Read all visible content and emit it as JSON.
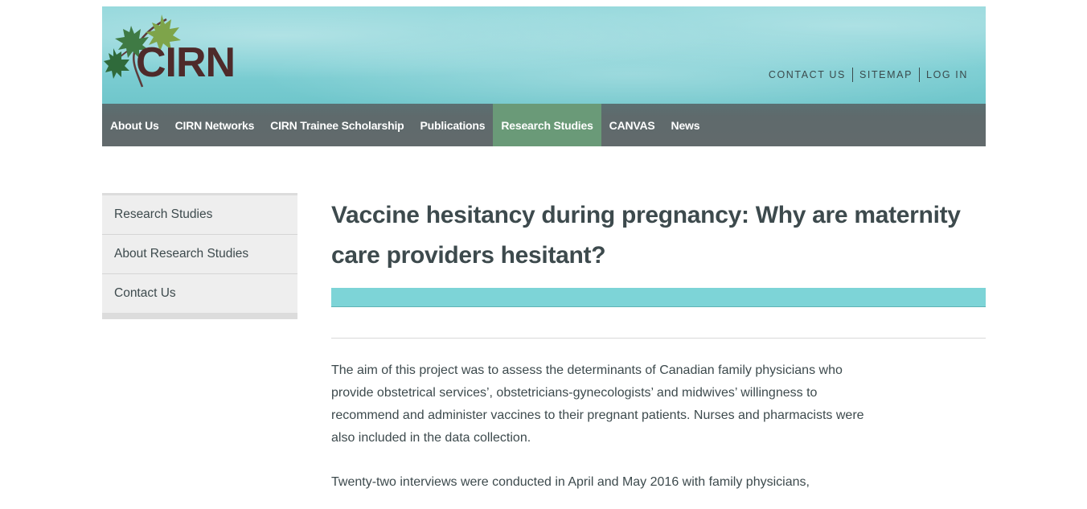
{
  "header": {
    "logo_text": "CIRN",
    "utility_links": [
      "CONTACT US",
      "SITEMAP",
      "LOG IN"
    ]
  },
  "nav": {
    "items": [
      "About Us",
      "CIRN Networks",
      "CIRN Trainee Scholarship",
      "Publications",
      "Research Studies",
      "CANVAS",
      "News"
    ],
    "active": "Research Studies"
  },
  "sidebar": {
    "items": [
      "Research Studies",
      "About Research Studies",
      "Contact Us"
    ]
  },
  "main": {
    "title": "Vaccine hesitancy during pregnancy: Why are maternity care providers hesitant?",
    "paragraphs": [
      "The aim of this project was to assess the determinants of Canadian family physicians who provide obstetrical services’, obstetricians-gynecologists’ and midwives’ willingness to recommend and administer vaccines to their pregnant patients. Nurses and pharmacists were also included in the data collection.",
      "Twenty-two interviews were conducted in April and May 2016 with family physicians,"
    ]
  },
  "colors": {
    "banner": "#7fcfd4",
    "nav_bg": "#626a6c",
    "nav_active": "#6a9a78",
    "accent_bar": "#7dd4d7",
    "logo_text": "#4e2a2a",
    "leaf_dark": "#2f6a3a",
    "leaf_light": "#7ea44a"
  },
  "icons": {
    "logo": "maple-leaf-logo-icon"
  }
}
